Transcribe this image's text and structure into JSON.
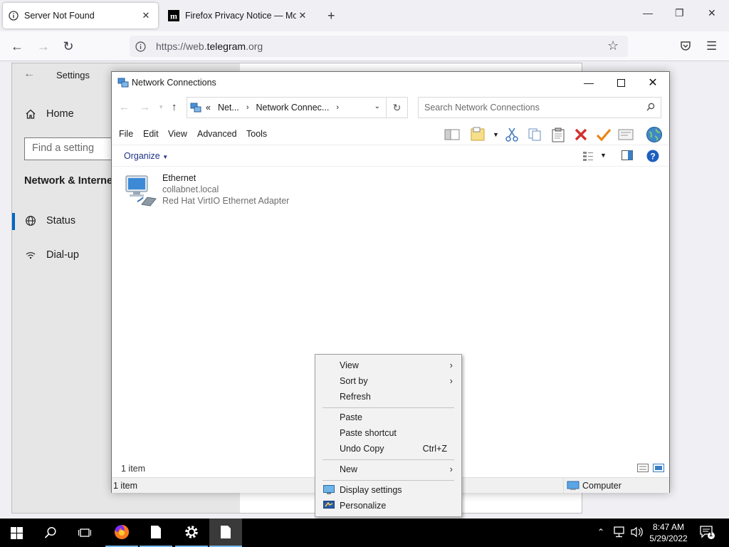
{
  "browser": {
    "tabs": [
      {
        "title": "Server Not Found",
        "icon": "info-icon",
        "active": true
      },
      {
        "title": "Firefox Privacy Notice — Mozilla",
        "icon": "mozilla-m-icon",
        "active": false
      }
    ],
    "url": {
      "scheme": "https://web.",
      "domain": "telegram",
      "rest": ".org"
    }
  },
  "settings": {
    "title": "Settings",
    "home": "Home",
    "search_placeholder": "Find a setting",
    "section": "Network & Internet",
    "nav": [
      {
        "label": "Status",
        "icon": "globe-status-icon",
        "selected": true
      },
      {
        "label": "Dial-up",
        "icon": "dialup-icon",
        "selected": false
      }
    ]
  },
  "netwin": {
    "title": "Network Connections",
    "breadcrumb": {
      "prefix": "«",
      "crumb1": "Net...",
      "crumb2": "Network Connec..."
    },
    "search_placeholder": "Search Network Connections",
    "menu": [
      "File",
      "Edit",
      "View",
      "Advanced",
      "Tools"
    ],
    "organize": "Organize",
    "item": {
      "name": "Ethernet",
      "domain": "collabnet.local",
      "adapter": "Red Hat VirtIO Ethernet Adapter"
    },
    "item_count": "1 item",
    "status_left": "1 item",
    "status_right": "Computer"
  },
  "context_menu": {
    "items": [
      {
        "label": "View",
        "submenu": true
      },
      {
        "label": "Sort by",
        "submenu": true
      },
      {
        "label": "Refresh"
      },
      {
        "label": "Paste"
      },
      {
        "label": "Paste shortcut"
      },
      {
        "label": "Undo Copy",
        "shortcut": "Ctrl+Z"
      },
      {
        "label": "New",
        "submenu": true
      },
      {
        "label": "Display settings",
        "icon": "display-icon"
      },
      {
        "label": "Personalize",
        "icon": "personalize-icon"
      }
    ]
  },
  "taskbar": {
    "time": "8:47 AM",
    "date": "5/29/2022",
    "notification_count": "1"
  },
  "colors": {
    "accent": "#0067c0",
    "taskbar": "#000000",
    "delete_red": "#d32f2f",
    "check_orange": "#e8861a"
  }
}
